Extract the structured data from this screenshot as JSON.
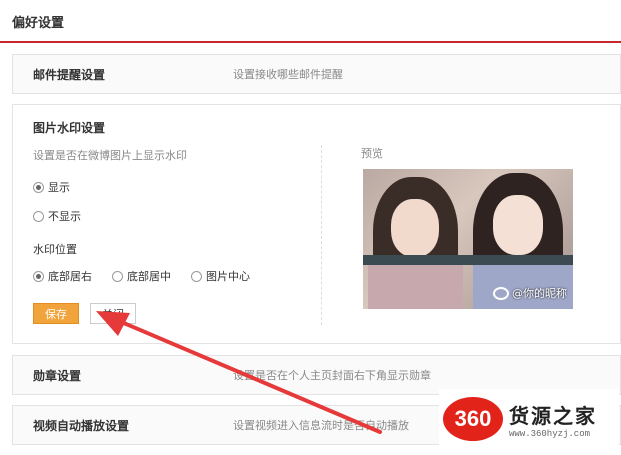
{
  "page": {
    "title": "偏好设置"
  },
  "mail": {
    "title": "邮件提醒设置",
    "desc": "设置接收哪些邮件提醒"
  },
  "watermark": {
    "title": "图片水印设置",
    "desc": "设置是否在微博图片上显示水印",
    "show_label": "显示",
    "hide_label": "不显示",
    "position_label": "水印位置",
    "positions": [
      "底部居右",
      "底部居中",
      "图片中心"
    ],
    "selected_position": "底部居右",
    "save_label": "保存",
    "close_label": "关闭",
    "preview_label": "预览",
    "watermark_text": "@你的昵称"
  },
  "medal": {
    "title": "勋章设置",
    "desc": "设置是否在个人主页封面右下角显示勋章"
  },
  "video": {
    "title": "视频自动播放设置",
    "desc": "设置视频进入信息流时是否自动播放"
  },
  "logo": {
    "badge": "360",
    "name": "货源之家",
    "url": "www.360hyzj.com"
  },
  "colors": {
    "accent_line": "#c8282c",
    "save_button": "#f0a43b",
    "arrow": "#e5393a",
    "logo_red": "#e2231a"
  }
}
